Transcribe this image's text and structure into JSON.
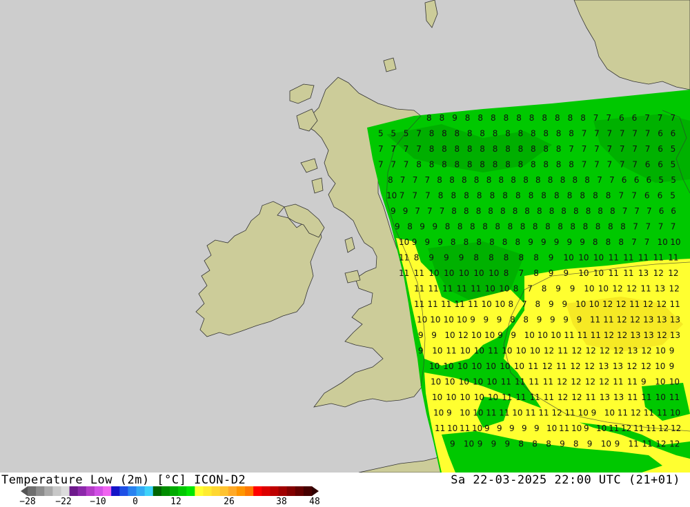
{
  "title": "Temperature Low (2m) [°C] ICON-D2",
  "timestamp": "Sa 22-03-2025 22:00 UTC (21+01)",
  "colors": {
    "sea": "#cdcdcd",
    "land": "#cccc99",
    "model_green": "#00c800",
    "model_dark_green": "#009a00",
    "model_yellow": "#ffff30",
    "model_light_yellow": "#f2e020"
  },
  "colorbar": {
    "tick_labels": [
      "-28",
      "-22",
      "-10",
      "0",
      "12",
      "26",
      "38",
      "48"
    ],
    "colors": [
      "#6e6e6e",
      "#8c8c8c",
      "#aaaaaa",
      "#c8c8c8",
      "#dcdcdc",
      "#6e1a8c",
      "#8c28aa",
      "#b43cc8",
      "#d250e6",
      "#f064f0",
      "#1414c8",
      "#1e50e6",
      "#2882f0",
      "#32aaf5",
      "#3cd2fa",
      "#006400",
      "#008c00",
      "#00aa00",
      "#00c800",
      "#00e600",
      "#ffff30",
      "#ffeb30",
      "#ffd730",
      "#ffc330",
      "#ffaa28",
      "#ff9600",
      "#ff7800",
      "#ff0000",
      "#dc0000",
      "#be0000",
      "#a00000",
      "#820000",
      "#640000",
      "#460000"
    ]
  },
  "temperature_rows": [
    "8 8 9 8 8 8 8 8 8 8 8 8 8 7 7 6 6 7 7 7",
    "5 5 5 7 8 8 8 8 8 8 8 8 8 8 8 8 7 7 7 7 7 7 6 6",
    "7 7 7 7 8 8 8 8 8 8 8 8 8 8 8 7 7 7 7 7 7 7 6 5",
    "7 7 7 8 8 8 8 8 8 8 8 8 8 8 8 8 7 7 7 7 7 6 6 5",
    "8 7 7 7 8 8 8 8 8 8 8 8 8 8 8 8 8 7 7 6 6 6 5 5",
    "10 7 7 7 8 8 8 8 8 8 8 8 8 8 8 8 8 8 7 7 6 6 5",
    "9 9 7 7 7 8 8 8 8 8 8 8 8 8 8 8 8 8 8 7 7 7 6 6",
    "9 8 9 9 8 8 8 8 8 8 8 8 8 8 8 8 8 8 8 7 7 7 7",
    "10 9 9 9 8 8 8 8 8 8 9 9 9 9 9 8 8 8 7 7 10 10",
    "11 8 9 9 9 8 8 8 8 8 9 10 10 10 11 11 11 11 11",
    "11 11 10 10 10 10 10 8 7 8 9 9 10 10 11 11 13 12 12",
    "11 11 11 11 11 10 10 8 7 8 9 9 10 10 12 12 11 13 12",
    "11 11 11 11 11 10 10 8 7 8 9 9 10 10 12 12 11 12 12 11",
    "10 10 10 10 9 9 9 8 8 9 9 9 9 11 11 12 12 13 13 13",
    "9 9 10 12 10 10 9 9 10 10 10 11 11 11 12 12 13 13 12 13",
    "9 10 11 10 10 11 10 10 10 12 11 12 12 12 12 13 12 10 9",
    "10 10 10 10 10 10 10 11 12 11 12 12 13 13 12 12 10 9",
    "10 10 10 10 10 11 11 11 11 12 12 12 12 11 11 9 10 10",
    "10 10 10 10 10 11 11 11 11 12 12 11 13 13 11 11 10 11",
    "10 9 10 10 11 11 10 11 11 12 11 10 9 10 11 12 11 11 10",
    "11 10 11 10 9 9 9 9 9 10 11 10 9 10 11 12 11 11 12 12",
    "9 10 9 9 9 8 8 8 9 8 9 10 9 11 11 12 12"
  ]
}
